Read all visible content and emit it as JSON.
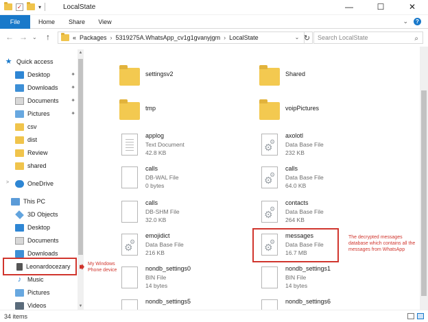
{
  "window": {
    "title": "LocalState",
    "minimize_glyph": "—",
    "maximize_glyph": "☐",
    "close_glyph": "✕"
  },
  "ribbon": {
    "tabs": [
      "File",
      "Home",
      "Share",
      "View"
    ],
    "expand_glyph": "⌄",
    "help_glyph": "?"
  },
  "address": {
    "back_glyph": "←",
    "forward_glyph": "→",
    "recent_glyph": "⌄",
    "up_glyph": "↑",
    "overflow": "«",
    "crumbs": [
      "Packages",
      "5319275A.WhatsApp_cv1g1gvanyjgm",
      "LocalState"
    ],
    "crumb_separator": "›",
    "dropdown_glyph": "⌄",
    "refresh_glyph": "↻",
    "search_placeholder": "Search LocalState",
    "search_glyph": "⌕"
  },
  "sidebar": {
    "quick_access": "Quick access",
    "quick_items": [
      "Desktop",
      "Downloads",
      "Documents",
      "Pictures",
      "csv",
      "dist",
      "Review",
      "shared"
    ],
    "pin_glyph": "📌",
    "onedrive": "OneDrive",
    "this_pc": "This PC",
    "pc_items": [
      "3D Objects",
      "Desktop",
      "Documents",
      "Downloads",
      "Leonardocezary",
      "Music",
      "Pictures",
      "Videos"
    ],
    "expand_glyph": ">",
    "scroll_up": "▲",
    "scroll_down": "▼"
  },
  "files": [
    {
      "name": "settingsv2",
      "type": "",
      "size": "",
      "kind": "folder"
    },
    {
      "name": "Shared",
      "type": "",
      "size": "",
      "kind": "folder"
    },
    {
      "name": "tmp",
      "type": "",
      "size": "",
      "kind": "folder"
    },
    {
      "name": "voipPictures",
      "type": "",
      "size": "",
      "kind": "folder"
    },
    {
      "name": "applog",
      "type": "Text Document",
      "size": "42.8 KB",
      "kind": "text"
    },
    {
      "name": "axolotl",
      "type": "Data Base File",
      "size": "232 KB",
      "kind": "db"
    },
    {
      "name": "calls",
      "type": "DB-WAL File",
      "size": "0 bytes",
      "kind": "blank"
    },
    {
      "name": "calls",
      "type": "Data Base File",
      "size": "64.0 KB",
      "kind": "db"
    },
    {
      "name": "calls",
      "type": "DB-SHM File",
      "size": "32.0 KB",
      "kind": "blank"
    },
    {
      "name": "contacts",
      "type": "Data Base File",
      "size": "264 KB",
      "kind": "db"
    },
    {
      "name": "emojidict",
      "type": "Data Base File",
      "size": "216 KB",
      "kind": "db"
    },
    {
      "name": "messages",
      "type": "Data Base File",
      "size": "16.7 MB",
      "kind": "db"
    },
    {
      "name": "nondb_settings0",
      "type": "BIN File",
      "size": "14 bytes",
      "kind": "blank"
    },
    {
      "name": "nondb_settings1",
      "type": "BIN File",
      "size": "14 bytes",
      "kind": "blank"
    },
    {
      "name": "nondb_settings5",
      "type": "",
      "size": "",
      "kind": "blank"
    },
    {
      "name": "nondb_settings6",
      "type": "",
      "size": "",
      "kind": "blank"
    }
  ],
  "annotations": {
    "messages_note": "The decrypted messages database which contains all the messages from WhatsApp",
    "device_note": "My Windows Phone device"
  },
  "status": {
    "count": "34 items"
  },
  "colors": {
    "accent": "#1979ca",
    "annotation_red": "#d0342c",
    "folder_yellow": "#f3c950"
  }
}
